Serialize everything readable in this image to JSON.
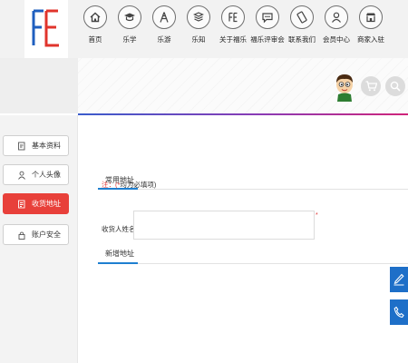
{
  "logo": {
    "text": "FE"
  },
  "nav": {
    "items": [
      {
        "label": "首页",
        "icon": "home-icon"
      },
      {
        "label": "乐学",
        "icon": "graduation-cap-icon"
      },
      {
        "label": "乐游",
        "icon": "tower-icon"
      },
      {
        "label": "乐知",
        "icon": "books-icon"
      },
      {
        "label": "关于福乐",
        "icon": "fe-logo-icon"
      },
      {
        "label": "福乐评审会",
        "icon": "chat-icon"
      },
      {
        "label": "联系我们",
        "icon": "phone-icon"
      },
      {
        "label": "会员中心",
        "icon": "user-icon"
      },
      {
        "label": "商家入驻",
        "icon": "shop-icon"
      }
    ]
  },
  "sidebar": {
    "items": [
      {
        "label": "基本资料",
        "icon": "edit-doc-icon",
        "active": false
      },
      {
        "label": "个人头像",
        "icon": "person-icon",
        "active": false
      },
      {
        "label": "收货地址",
        "icon": "address-icon",
        "active": true
      },
      {
        "label": "账户安全",
        "icon": "lock-icon",
        "active": false
      }
    ]
  },
  "main": {
    "common_address_title": "常用地址",
    "new_address_title": "新增地址",
    "required_note_prefix": "注：",
    "required_note_star": "(*",
    "required_note_text": "均为必填项)",
    "recipient_label": "收货人姓名：",
    "recipient_value": "",
    "required_star": "*"
  },
  "colors": {
    "accent_red": "#e8403a",
    "accent_blue": "#1e7fd0",
    "float_blue": "#1e6fc8",
    "logo_blue": "#1f5fbf",
    "logo_red": "#e0342c"
  }
}
